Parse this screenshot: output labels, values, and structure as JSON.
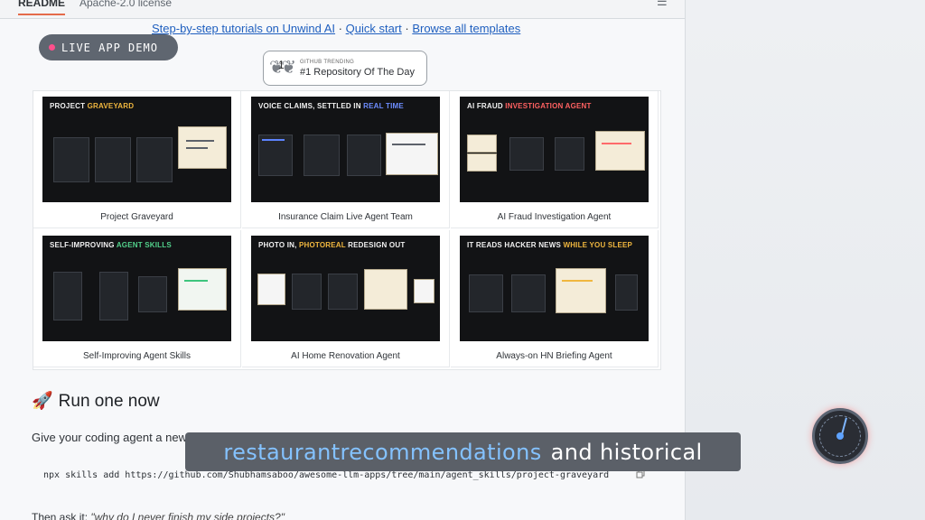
{
  "tabs": {
    "readme": "README",
    "license": "Apache-2.0 license"
  },
  "header": {
    "links": {
      "tutorials": "Step-by-step tutorials on Unwind AI",
      "separator1": " · ",
      "quickstart": "Quick start",
      "separator2": " · ",
      "templates": "Browse all templates"
    },
    "live_badge": "LIVE APP DEMO",
    "trending_top": "GITHUB TRENDING",
    "trending_number": "1",
    "trending_main": "#1 Repository Of The Day"
  },
  "cards": [
    {
      "caption": "Project Graveyard",
      "thumb_title_a": "Project ",
      "thumb_title_b": "Graveyard"
    },
    {
      "caption": "Insurance Claim Live Agent Team",
      "thumb_title_a": "Voice claims, settled in ",
      "thumb_title_b": "real time"
    },
    {
      "caption": "AI Fraud Investigation Agent",
      "thumb_title_a": "AI Fraud ",
      "thumb_title_b": "Investigation Agent"
    },
    {
      "caption": "Self-Improving Agent Skills",
      "thumb_title_a": "Self-improving ",
      "thumb_title_b": "agent skills"
    },
    {
      "caption": "AI Home Renovation Agent",
      "thumb_title_a": "Photo in, ",
      "thumb_title_b": "photoreal",
      "thumb_title_c": " redesign out"
    },
    {
      "caption": "Always-on HN Briefing Agent",
      "thumb_title_a": "It reads Hacker News ",
      "thumb_title_b": "while you sleep"
    }
  ],
  "section": {
    "title": "Run one now",
    "prompt": "Give your coding agent a new",
    "command": "npx skills add https://github.com/Shubhamsaboo/awesome-llm-apps/tree/main/agent_skills/project-graveyard",
    "ask_prefix": "Then ask it: ",
    "ask_quote": "\"why do I never finish my side projects?\""
  },
  "subtitle": {
    "highlight": "restaurantrecommendations",
    "rest": "and  historical"
  },
  "icons": {
    "toc": "list-icon",
    "copy": "copy-icon",
    "rocket": "rocket-icon",
    "gauge": "gauge-icon"
  },
  "colors": {
    "accent": "#e46b4a",
    "link": "#1f5fbf",
    "subtitle_highlight": "#84c2ff"
  }
}
